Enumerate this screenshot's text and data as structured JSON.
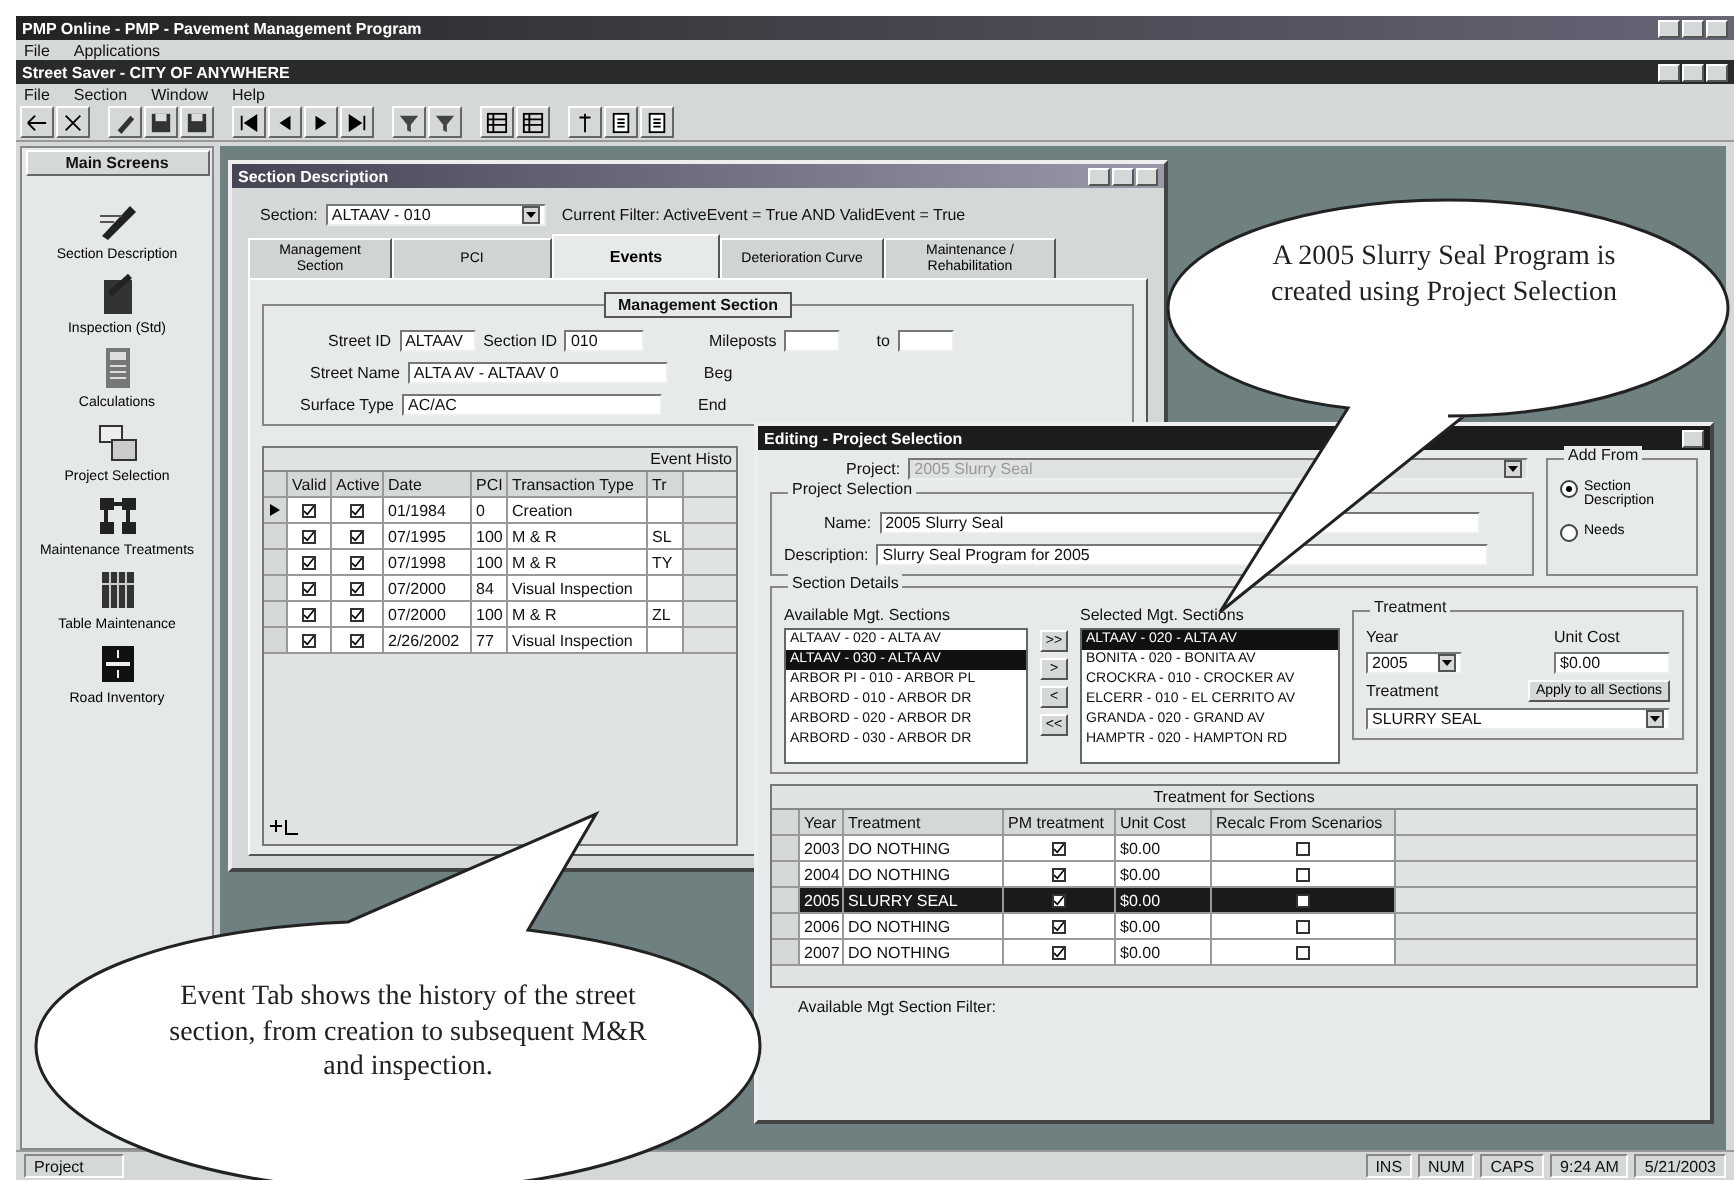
{
  "app": {
    "title": "PMP Online - PMP - Pavement Management Program",
    "menu": [
      "File",
      "Applications"
    ]
  },
  "document": {
    "title": "Street Saver - CITY OF ANYWHERE",
    "menu": [
      "File",
      "Section",
      "Window",
      "Help"
    ]
  },
  "sidebar": {
    "title": "Main Screens",
    "items": [
      {
        "label": "Section Description",
        "kind": "pen"
      },
      {
        "label": "Inspection (Std)",
        "kind": "clipboard"
      },
      {
        "label": "Calculations",
        "kind": "calculator"
      },
      {
        "label": "Project Selection",
        "kind": "folders"
      },
      {
        "label": "Maintenance Treatments",
        "kind": "network"
      },
      {
        "label": "Table Maintenance",
        "kind": "table"
      },
      {
        "label": "Road Inventory",
        "kind": "road"
      }
    ]
  },
  "section_window": {
    "title": "Section Description",
    "section_label": "Section:",
    "section_value": "ALTAAV - 010",
    "filter": "Current Filter: ActiveEvent = True AND ValidEvent = True",
    "tabs": [
      {
        "label": "Management Section",
        "selected": false
      },
      {
        "label": "PCI",
        "selected": false
      },
      {
        "label": "Events",
        "selected": true
      },
      {
        "label": "Deterioration Curve",
        "selected": false
      },
      {
        "label": "Maintenance / Rehabilitation",
        "selected": false
      }
    ],
    "group_title": "Management Section",
    "street_id_label": "Street ID",
    "street_id": "ALTAAV",
    "section_id_label": "Section ID",
    "section_id": "010",
    "mileposts_label": "Mileposts",
    "to_label": "to",
    "street_name_label": "Street Name",
    "street_name": "ALTA AV - ALTAAV 0",
    "beg_label": "Beg",
    "surface_label": "Surface Type",
    "surface": "AC/AC",
    "end_label": "End",
    "grid_title": "Event Histo",
    "columns": [
      "Valid",
      "Active",
      "Date",
      "PCI",
      "Transaction Type",
      "Tr"
    ],
    "rows": [
      {
        "selected": true,
        "valid": true,
        "active": true,
        "date": "01/1984",
        "pci": "0",
        "type": "Creation",
        "tr": ""
      },
      {
        "selected": false,
        "valid": true,
        "active": true,
        "date": "07/1995",
        "pci": "100",
        "type": "M & R",
        "tr": "SL"
      },
      {
        "selected": false,
        "valid": true,
        "active": true,
        "date": "07/1998",
        "pci": "100",
        "type": "M & R",
        "tr": "TY"
      },
      {
        "selected": false,
        "valid": true,
        "active": true,
        "date": "07/2000",
        "pci": "84",
        "type": "Visual Inspection",
        "tr": ""
      },
      {
        "selected": false,
        "valid": true,
        "active": true,
        "date": "07/2000",
        "pci": "100",
        "type": "M & R",
        "tr": "ZL"
      },
      {
        "selected": false,
        "valid": true,
        "active": true,
        "date": "2/26/2002",
        "pci": "77",
        "type": "Visual Inspection",
        "tr": ""
      }
    ]
  },
  "project_dialog": {
    "title": "Editing - Project Selection",
    "project_label": "Project:",
    "project_value": "2005 Slurry Seal",
    "selection_title": "Project Selection",
    "name_label": "Name:",
    "name_value": "2005 Slurry Seal",
    "description_label": "Description:",
    "description_value": "Slurry Seal Program for 2005",
    "add_from_title": "Add From",
    "add_from": [
      {
        "label": "Section Description",
        "selected": true
      },
      {
        "label": "Needs",
        "selected": false
      }
    ],
    "details_title": "Section Details",
    "available_label": "Available Mgt. Sections",
    "available": [
      {
        "label": "ALTAAV - 020 - ALTA AV",
        "selected": false
      },
      {
        "label": "ALTAAV - 030 - ALTA AV",
        "selected": true
      },
      {
        "label": "ARBOR PI - 010 - ARBOR PL",
        "selected": false
      },
      {
        "label": "ARBORD - 010 - ARBOR DR",
        "selected": false
      },
      {
        "label": "ARBORD - 020 - ARBOR DR",
        "selected": false
      },
      {
        "label": "ARBORD - 030 - ARBOR DR",
        "selected": false
      }
    ],
    "move_buttons": [
      ">>",
      ">",
      "<",
      "<<"
    ],
    "selected_label": "Selected Mgt. Sections",
    "chosen": [
      {
        "label": "ALTAAV - 020 - ALTA AV",
        "selected": true
      },
      {
        "label": "BONITA - 020 - BONITA AV",
        "selected": false
      },
      {
        "label": "CROCKRA - 010 - CROCKER AV",
        "selected": false
      },
      {
        "label": "ELCERR - 010 - EL CERRITO AV",
        "selected": false
      },
      {
        "label": "GRANDA - 020 - GRAND AV",
        "selected": false
      },
      {
        "label": "HAMPTR - 020 - HAMPTON RD",
        "selected": false
      }
    ],
    "treatment_title": "Treatment",
    "year_label": "Year",
    "year_value": "2005",
    "unit_cost_label": "Unit Cost",
    "unit_cost_value": "$0.00",
    "treatment_label": "Treatment",
    "apply_button": "Apply to all Sections",
    "treatment_value": "SLURRY SEAL",
    "grid_title": "Treatment for Sections",
    "columns": [
      "Year",
      "Treatment",
      "PM treatment",
      "Unit Cost",
      "Recalc From Scenarios"
    ],
    "rows": [
      {
        "selected": false,
        "year": "2003",
        "treatment": "DO NOTHING",
        "pm": true,
        "unit_cost": "$0.00",
        "recalc": false
      },
      {
        "selected": false,
        "year": "2004",
        "treatment": "DO NOTHING",
        "pm": true,
        "unit_cost": "$0.00",
        "recalc": false
      },
      {
        "selected": true,
        "year": "2005",
        "treatment": "SLURRY SEAL",
        "pm": true,
        "unit_cost": "$0.00",
        "recalc": false
      },
      {
        "selected": false,
        "year": "2006",
        "treatment": "DO NOTHING",
        "pm": true,
        "unit_cost": "$0.00",
        "recalc": false
      },
      {
        "selected": false,
        "year": "2007",
        "treatment": "DO NOTHING",
        "pm": true,
        "unit_cost": "$0.00",
        "recalc": false
      }
    ],
    "footer": "Available Mgt Section Filter:"
  },
  "callouts": [
    {
      "text": "A 2005 Slurry Seal Program is created using Project Selection"
    },
    {
      "text": "Event Tab shows the history of the street section, from creation to subsequent M&R and inspection."
    }
  ],
  "status_bar": {
    "left": "Project",
    "panels": [
      "INS",
      "NUM",
      "CAPS",
      "9:24 AM",
      "5/21/2003"
    ]
  }
}
